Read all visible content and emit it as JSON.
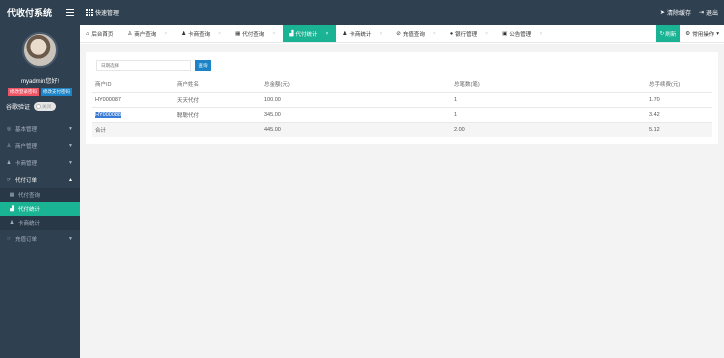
{
  "app": {
    "title": "代收付系统",
    "quick_label": "快速管理",
    "top_actions": [
      "清除缓存",
      "退出"
    ]
  },
  "sidebar": {
    "username": "myadmin您好!",
    "btn_change_login": "修改登录密码",
    "btn_change_pay": "修改支付密码",
    "google_auth_label": "谷歌验证",
    "google_auth_state": "关闭",
    "menu": [
      {
        "label": "基本管理",
        "icon": "circle-icon"
      },
      {
        "label": "商户管理",
        "icon": "user-icon"
      },
      {
        "label": "卡商管理",
        "icon": "users-icon"
      },
      {
        "label": "代付订单",
        "icon": "order-icon"
      },
      {
        "label": "充值订单",
        "icon": "order-icon"
      }
    ],
    "submenu": [
      {
        "label": "代付查询",
        "icon": "table-icon"
      },
      {
        "label": "代付统计",
        "icon": "bar-chart-icon"
      },
      {
        "label": "卡商统计",
        "icon": "group-icon"
      }
    ]
  },
  "tabs": [
    {
      "label": "后台首页",
      "icon": "home-icon"
    },
    {
      "label": "商户查询",
      "icon": "user-icon"
    },
    {
      "label": "卡商查询",
      "icon": "users-icon"
    },
    {
      "label": "代付查询",
      "icon": "table-icon"
    },
    {
      "label": "代付统计",
      "icon": "bar-chart-icon"
    },
    {
      "label": "卡商统计",
      "icon": "group-icon"
    },
    {
      "label": "充值查询",
      "icon": "check-icon"
    },
    {
      "label": "银行管理",
      "icon": "info-icon"
    },
    {
      "label": "公告管理",
      "icon": "calendar-icon"
    }
  ],
  "tabbar": {
    "refresh": "刷新",
    "ops": "常用操作"
  },
  "search": {
    "placeholder": "日期选择",
    "button": "查询"
  },
  "table": {
    "headers": [
      "商户ID",
      "商户姓名",
      "总金额(元)",
      "总笔数(笔)",
      "总手续费(元)"
    ],
    "rows": [
      [
        "HY000087",
        "天天代付",
        "100.00",
        "1",
        "1.70"
      ],
      [
        "HY000088",
        "聪聪代付",
        "345.00",
        "1",
        "3.42"
      ]
    ],
    "total": [
      "合计",
      "",
      "445.00",
      "2.00",
      "5.12"
    ]
  },
  "colors": {
    "sidebar": "#2f4050",
    "accent": "#1ab394",
    "primary": "#1c84c6",
    "danger": "#ed5565"
  }
}
